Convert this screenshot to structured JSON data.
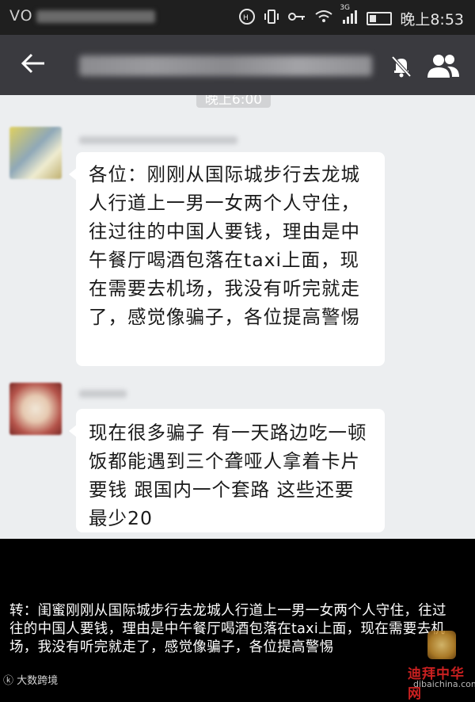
{
  "status_bar": {
    "carrier": "VO",
    "network": "3G",
    "time": "晚上8:53"
  },
  "chat_header": {
    "back_icon": "back-arrow-icon",
    "mute_icon": "mute-bell-icon",
    "members_icon": "group-members-icon"
  },
  "chat": {
    "timestamp": "晚上6:00",
    "messages": [
      {
        "text": "各位：刚刚从国际城步行去龙城人行道上一男一女两个人守住，往过往的中国人要钱，理由是中午餐厅喝酒包落在taxi上面，现在需要去机场，我没有听完就走了，感觉像骗子，各位提高警惕"
      },
      {
        "text": "现在很多骗子 有一天路边吃一顿饭都能遇到三个聋哑人拿着卡片要钱 跟国内一个套路 这些还要最少20"
      }
    ]
  },
  "caption": {
    "text": "转：闺蜜刚刚从国际城步行去龙城人行道上一男一女两个人守住，往过往的中国人要钱，理由是中午餐厅喝酒包落在taxi上面，现在需要去机场，我没有听完就走了，感觉像骗子，各位提高警惕"
  },
  "footer": {
    "source": "大数跨境",
    "watermark": "迪拜中华网",
    "watermark_url": "dibaichina.com"
  },
  "colors": {
    "title_bar": "#3a3a3f",
    "chat_bg": "#eceef0",
    "bubble": "#ffffff",
    "watermark": "#c92020"
  }
}
